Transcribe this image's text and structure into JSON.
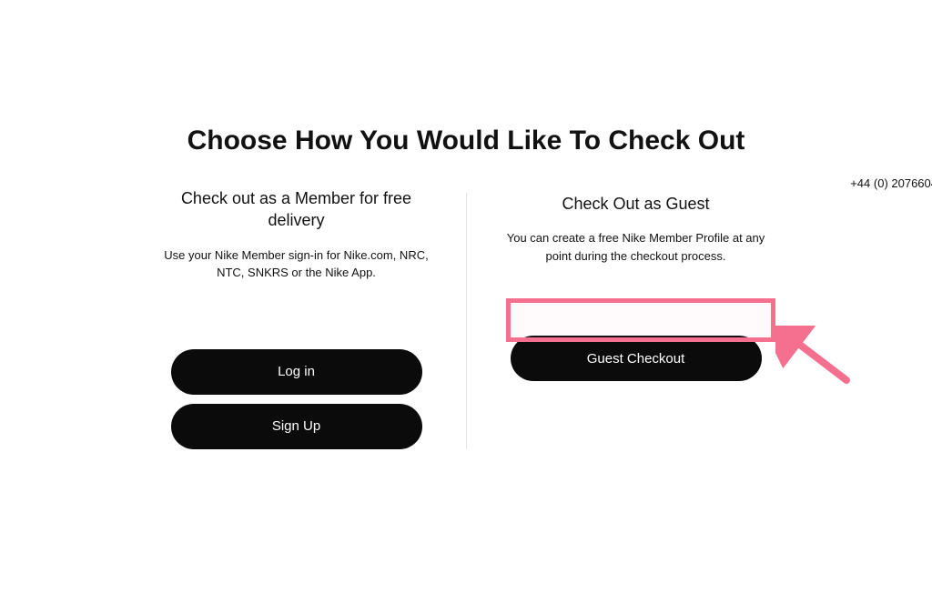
{
  "header": {
    "phone": "+44 (0) 2076604"
  },
  "title": "Choose How You Would Like To Check Out",
  "member": {
    "heading": "Check out as a Member for free delivery",
    "subtext": "Use your Nike Member sign-in for Nike.com, NRC, NTC, SNKRS or the Nike App.",
    "login_label": "Log in",
    "signup_label": "Sign Up"
  },
  "guest": {
    "heading": "Check Out as Guest",
    "subtext": "You can create a free Nike Member Profile at any point during the checkout process.",
    "checkout_label": "Guest Checkout"
  },
  "annotation": {
    "color": "#f56f8f"
  }
}
